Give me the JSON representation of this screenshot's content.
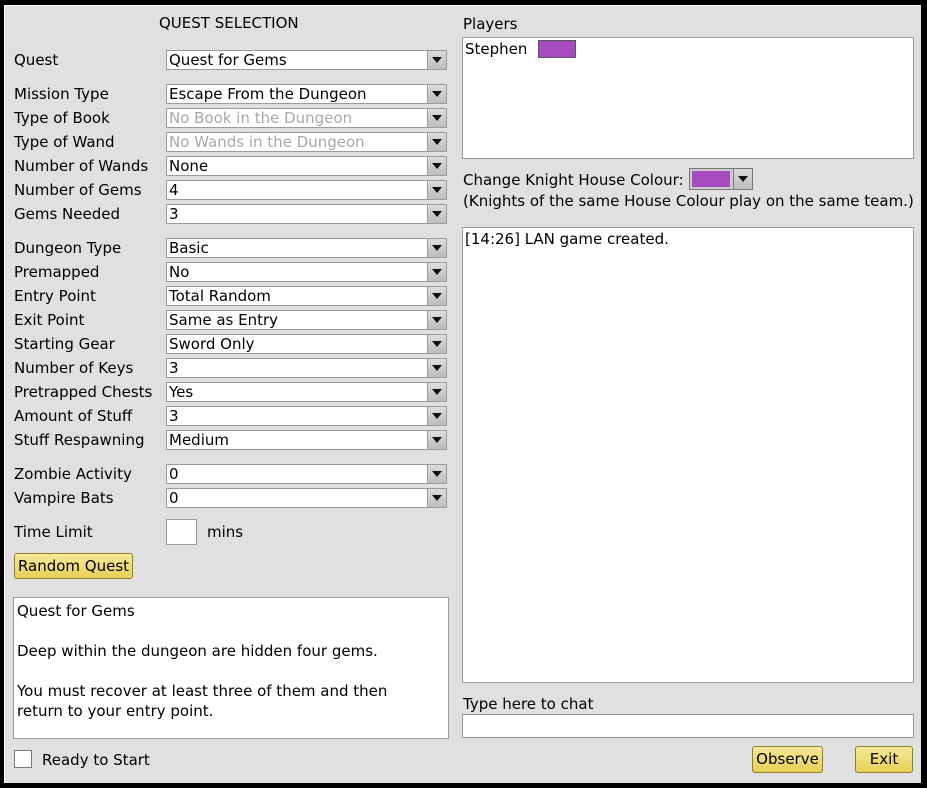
{
  "title": "QUEST SELECTION",
  "fields": [
    {
      "label": "Quest",
      "value": "Quest for Gems",
      "disabled": false
    },
    {
      "label": "Mission Type",
      "value": "Escape From the Dungeon",
      "disabled": false
    },
    {
      "label": "Type of Book",
      "value": "No Book in the Dungeon",
      "disabled": true
    },
    {
      "label": "Type of Wand",
      "value": "No Wands in the Dungeon",
      "disabled": true
    },
    {
      "label": "Number of Wands",
      "value": "None",
      "disabled": false
    },
    {
      "label": "Number of Gems",
      "value": "4",
      "disabled": false
    },
    {
      "label": "Gems Needed",
      "value": "3",
      "disabled": false
    },
    {
      "label": "Dungeon Type",
      "value": "Basic",
      "disabled": false
    },
    {
      "label": "Premapped",
      "value": "No",
      "disabled": false
    },
    {
      "label": "Entry Point",
      "value": "Total Random",
      "disabled": false
    },
    {
      "label": "Exit Point",
      "value": "Same as Entry",
      "disabled": false
    },
    {
      "label": "Starting Gear",
      "value": "Sword Only",
      "disabled": false
    },
    {
      "label": "Number of Keys",
      "value": "3",
      "disabled": false
    },
    {
      "label": "Pretrapped Chests",
      "value": "Yes",
      "disabled": false
    },
    {
      "label": "Amount of Stuff",
      "value": "3",
      "disabled": false
    },
    {
      "label": "Stuff Respawning",
      "value": "Medium",
      "disabled": false
    },
    {
      "label": "Zombie Activity",
      "value": "0",
      "disabled": false
    },
    {
      "label": "Vampire Bats",
      "value": "0",
      "disabled": false
    }
  ],
  "time_limit": {
    "label": "Time Limit",
    "value": "",
    "unit": "mins"
  },
  "random_quest_button": "Random Quest",
  "description": {
    "title": "Quest for Gems",
    "para1": "Deep within the dungeon are hidden four gems.",
    "para2": "You must recover at least three of them and then return to your entry point."
  },
  "ready": {
    "label": "Ready to Start",
    "checked": false
  },
  "players": {
    "label": "Players",
    "list": [
      {
        "name": "Stephen",
        "color": "#a64cc0"
      }
    ]
  },
  "house_colour": {
    "label": "Change Knight House Colour:",
    "color": "#a64cc0",
    "note": "(Knights of the same House Colour play on the same team.)"
  },
  "chat": {
    "log": [
      "[14:26] LAN game created."
    ],
    "input_label": "Type here to chat",
    "input_value": ""
  },
  "buttons": {
    "observe": "Observe",
    "exit": "Exit"
  }
}
